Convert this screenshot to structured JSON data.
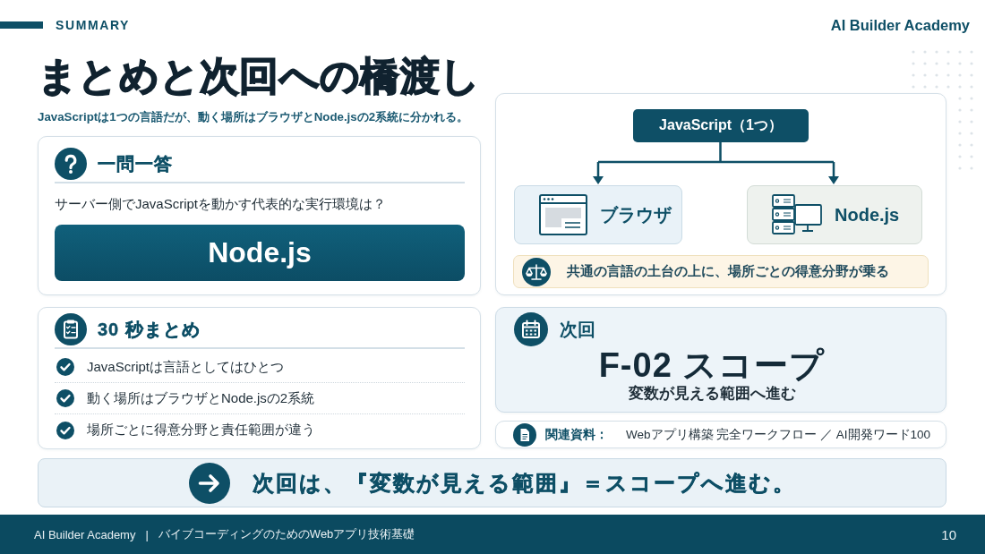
{
  "header": {
    "section_label": "SUMMARY",
    "brand": "AI Builder Academy"
  },
  "title": "まとめと次回への橋渡し",
  "subtitle": "JavaScriptは1つの言語だが、動く場所はブラウザとNode.jsの2系統に分かれる。",
  "quiz_card": {
    "heading": "一問一答",
    "question": "サーバー側でJavaScriptを動かす代表的な実行環境は？",
    "answer": "Node.js"
  },
  "summary_card": {
    "heading": "30 秒まとめ",
    "items": [
      {
        "text": "JavaScriptは言語としてはひとつ",
        "checked": true
      },
      {
        "text": "動く場所はブラウザとNode.jsの2系統",
        "checked": true
      },
      {
        "text": "場所ごとに得意分野と責任範囲が違う",
        "checked": true
      }
    ]
  },
  "diagram": {
    "root": "JavaScript（1つ）",
    "branches": [
      {
        "kind": "browser",
        "label": "ブラウザ"
      },
      {
        "kind": "server",
        "label": "Node.js"
      }
    ],
    "note": "共通の言語の土台の上に、場所ごとの得意分野が乗る"
  },
  "next_card": {
    "label": "次回",
    "title": "F-02 スコープ",
    "subtitle": "変数が見える範囲へ進む"
  },
  "related": {
    "label": "関連資料：",
    "text": "Webアプリ構築 完全ワークフロー ／ AI開発ワード100"
  },
  "banner": "次回は、『変数が見える範囲』＝スコープへ進む。",
  "footer": {
    "brand": "AI Builder Academy",
    "separator": "|",
    "course": "バイブコーディングのためのWebアプリ技術基礎",
    "page": "10"
  }
}
